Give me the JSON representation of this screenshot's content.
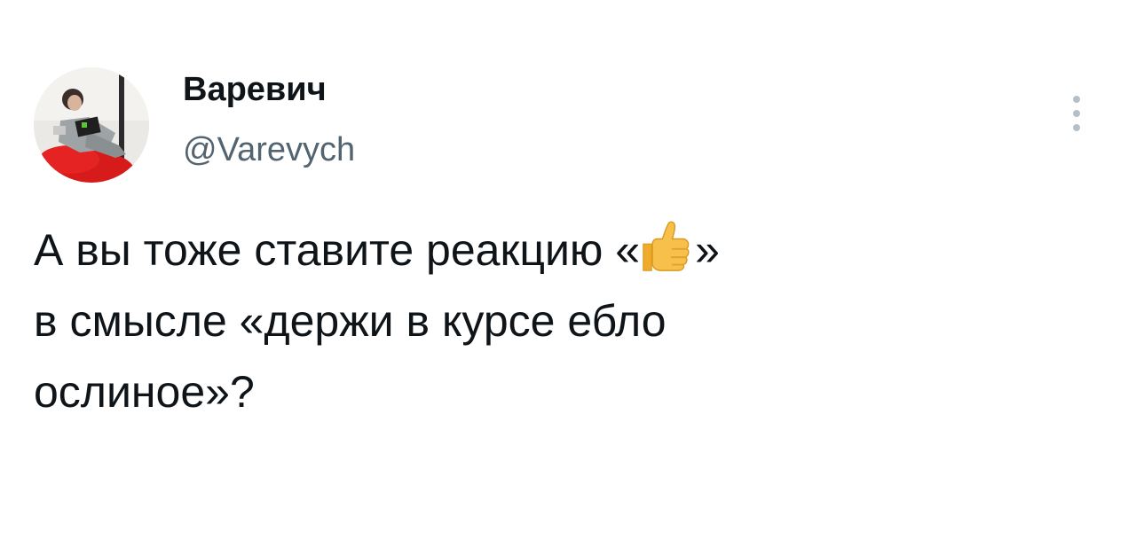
{
  "author": {
    "display_name": "Варевич",
    "handle": "@Varevych"
  },
  "tweet": {
    "line1_before_emoji": "А вы тоже ставите реакцию «",
    "emoji_icon": "thumbs-up-icon",
    "line1_after_emoji": "»",
    "line2": "в смысле «держи в курсе ебло",
    "line3": "ослиное»?"
  },
  "colors": {
    "text": "#0f1419",
    "handle": "#536471",
    "more_dots": "#b8c0c7",
    "avatar_red": "#d71a1a"
  },
  "icons": {
    "more": "more-vertical-icon"
  }
}
